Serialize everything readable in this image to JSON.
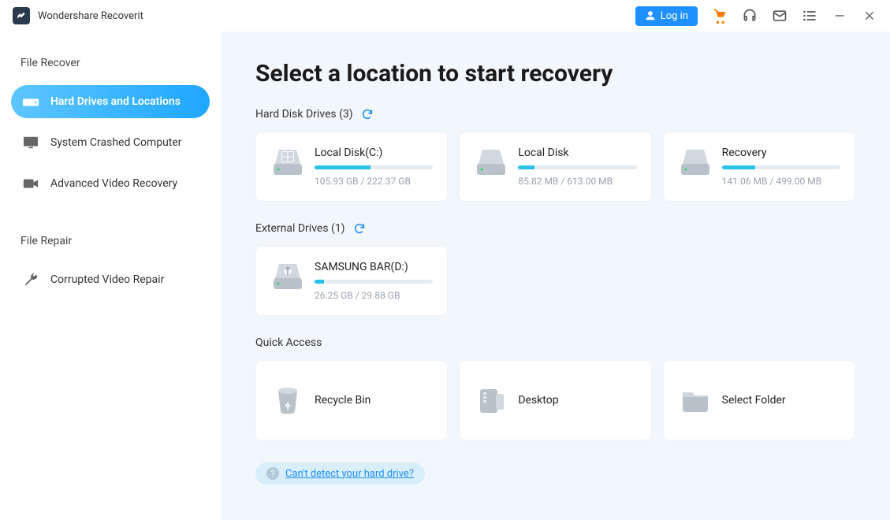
{
  "app": {
    "title": "Wondershare Recoverit"
  },
  "header": {
    "login_label": "Log in"
  },
  "sidebar": {
    "section1_label": "File Recover",
    "section2_label": "File Repair",
    "items": [
      {
        "label": "Hard Drives and Locations"
      },
      {
        "label": "System Crashed Computer"
      },
      {
        "label": "Advanced Video Recovery"
      },
      {
        "label": "Corrupted Video Repair"
      }
    ]
  },
  "main": {
    "page_title": "Select a location to start recovery",
    "hdd_label": "Hard Disk Drives (3)",
    "ext_label": "External Drives (1)",
    "qa_label": "Quick Access",
    "help_link": "Can't detect your hard drive?",
    "hdd": [
      {
        "name": "Local Disk(C:)",
        "used": "105.93 GB",
        "total": "222.37 GB",
        "pct": 47
      },
      {
        "name": "Local Disk",
        "used": "85.82 MB",
        "total": "613.00 MB",
        "pct": 14
      },
      {
        "name": "Recovery",
        "used": "141.06 MB",
        "total": "499.00 MB",
        "pct": 28
      }
    ],
    "external": [
      {
        "name": "SAMSUNG BAR(D:)",
        "used": "26.25 GB",
        "total": "29.88 GB",
        "pct": 8
      }
    ],
    "qa": [
      {
        "name": "Recycle Bin"
      },
      {
        "name": "Desktop"
      },
      {
        "name": "Select Folder"
      }
    ]
  }
}
